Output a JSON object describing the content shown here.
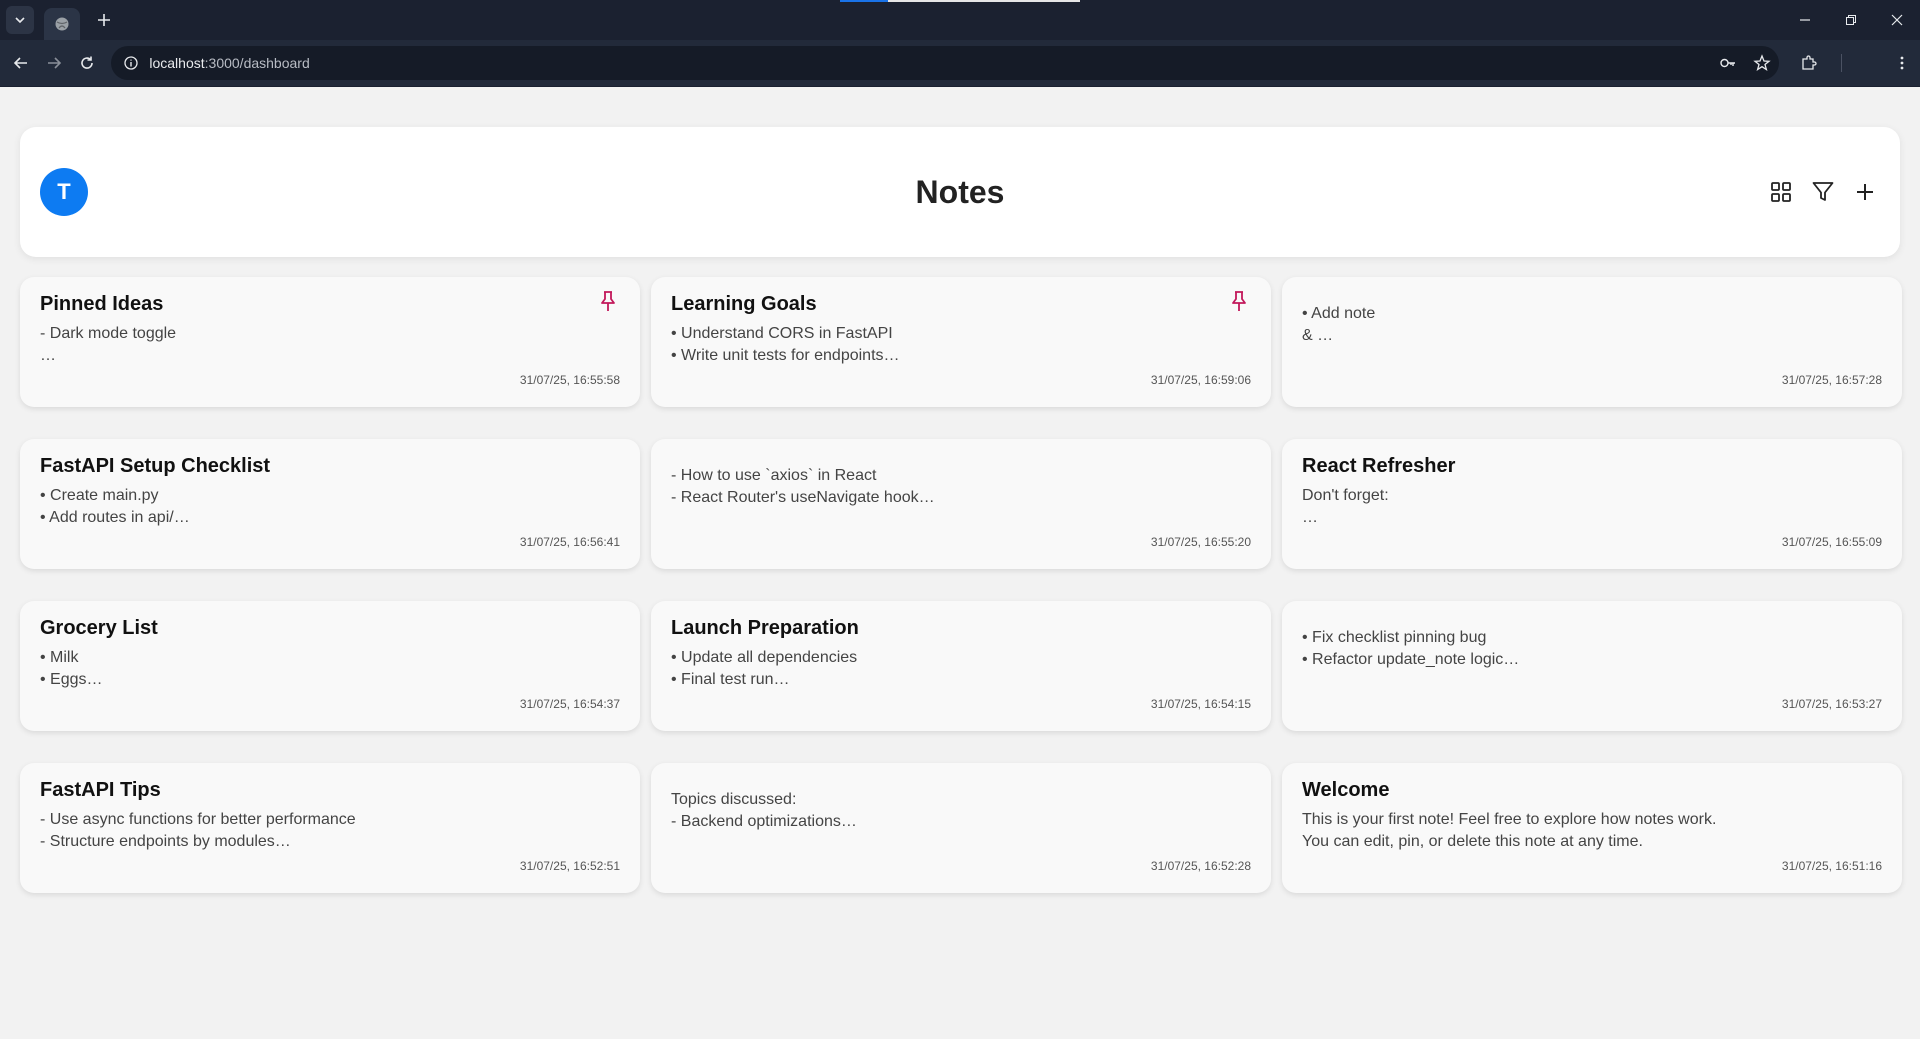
{
  "browser": {
    "url_host": "localhost",
    "url_path": ":3000/dashboard"
  },
  "header": {
    "avatar_initial": "T",
    "title": "Notes",
    "accent_color": "#0d7bf2"
  },
  "notes": [
    {
      "title": "Pinned Ideas",
      "body": "- Dark mode toggle\n…",
      "timestamp": "31/07/25, 16:55:58",
      "pinned": true
    },
    {
      "title": "Learning Goals",
      "body": "• Understand CORS in FastAPI\n• Write unit tests for endpoints…",
      "timestamp": "31/07/25, 16:59:06",
      "pinned": true
    },
    {
      "title": "",
      "body": "• Add note\n& …",
      "timestamp": "31/07/25, 16:57:28",
      "pinned": false
    },
    {
      "title": "FastAPI Setup Checklist",
      "body": "• Create main.py\n• Add routes in api/…",
      "timestamp": "31/07/25, 16:56:41",
      "pinned": false
    },
    {
      "title": "",
      "body": "- How to use `axios` in React\n- React Router's useNavigate hook…",
      "timestamp": "31/07/25, 16:55:20",
      "pinned": false
    },
    {
      "title": "React Refresher",
      "body": "Don't forget:\n…",
      "timestamp": "31/07/25, 16:55:09",
      "pinned": false
    },
    {
      "title": "Grocery List",
      "body": "• Milk\n• Eggs…",
      "timestamp": "31/07/25, 16:54:37",
      "pinned": false
    },
    {
      "title": "Launch Preparation",
      "body": "• Update all dependencies\n• Final test run…",
      "timestamp": "31/07/25, 16:54:15",
      "pinned": false
    },
    {
      "title": "",
      "body": "• Fix checklist pinning bug\n• Refactor update_note logic…",
      "timestamp": "31/07/25, 16:53:27",
      "pinned": false
    },
    {
      "title": "FastAPI Tips",
      "body": "- Use async functions for better performance\n- Structure endpoints by modules…",
      "timestamp": "31/07/25, 16:52:51",
      "pinned": false
    },
    {
      "title": "",
      "body": "Topics discussed:\n- Backend optimizations…",
      "timestamp": "31/07/25, 16:52:28",
      "pinned": false
    },
    {
      "title": "Welcome",
      "body": "This is your first note! Feel free to explore how notes work.\nYou can edit, pin, or delete this note at any time.",
      "timestamp": "31/07/25, 16:51:16",
      "pinned": false
    }
  ],
  "colors": {
    "pin": "#c2185b",
    "chrome_bg": "#1b2130"
  }
}
